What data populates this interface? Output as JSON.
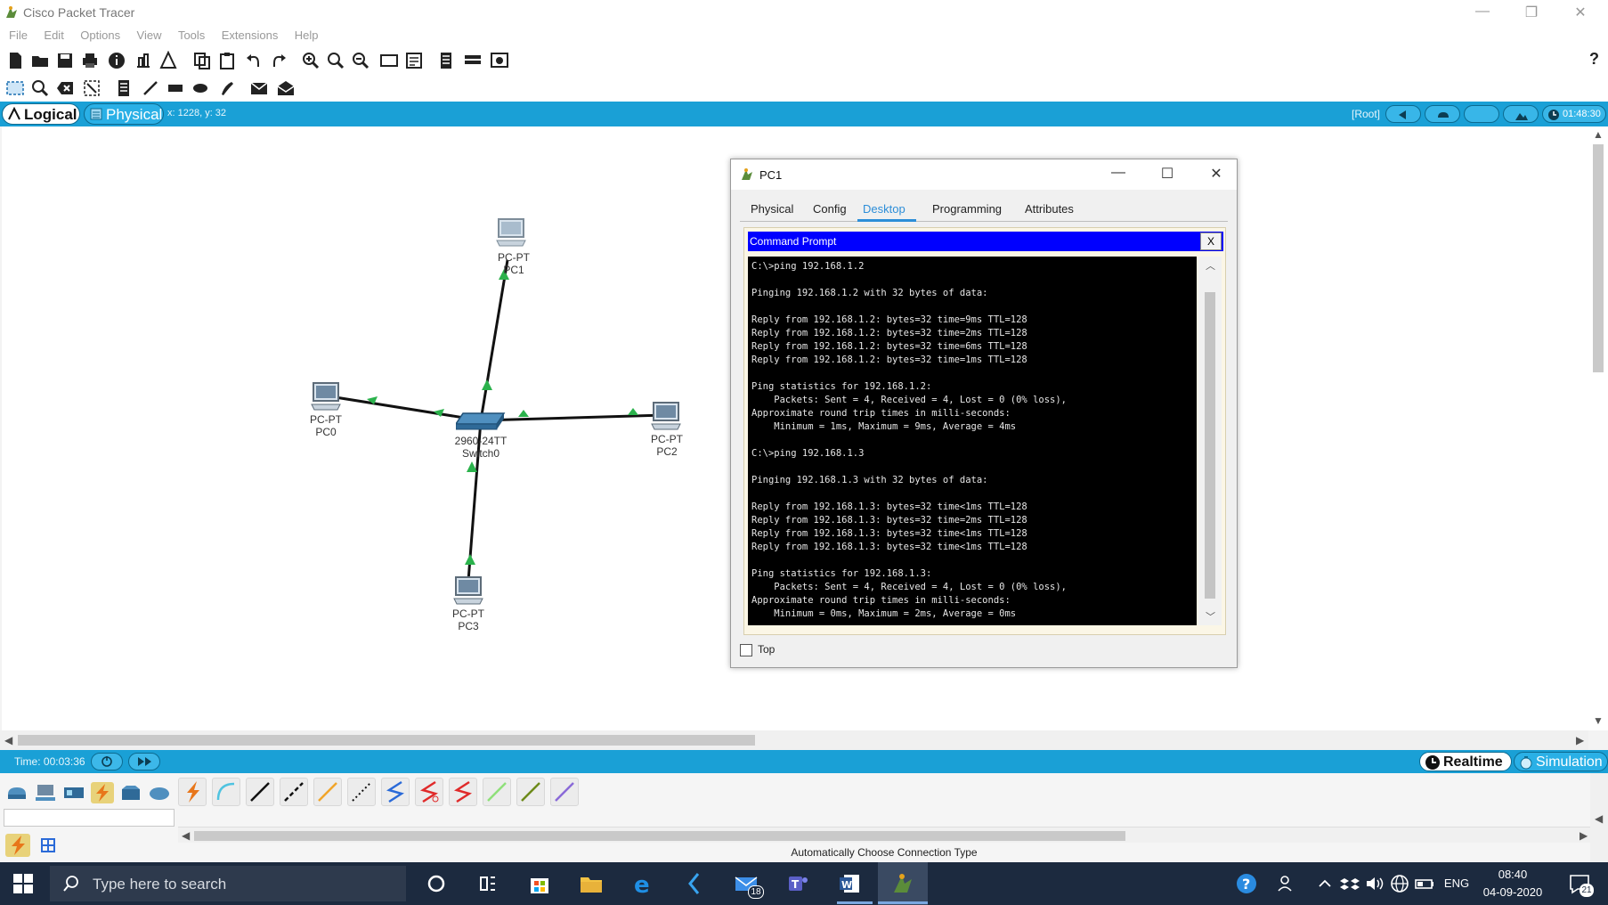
{
  "window": {
    "title": "Cisco Packet Tracer",
    "controls": {
      "minimize": "—",
      "restore": "❐",
      "close": "✕"
    }
  },
  "menu": [
    "File",
    "Edit",
    "Options",
    "View",
    "Tools",
    "Extensions",
    "Help"
  ],
  "toolbar": {
    "help": "?"
  },
  "workspace": {
    "logical_label": "Logical",
    "physical_label": "Physical",
    "coords": "x: 1228, y: 32",
    "root_label": "[Root]",
    "clock": "01:48:30"
  },
  "devices": [
    {
      "model": "PC-PT",
      "name": "PC1"
    },
    {
      "model": "PC-PT",
      "name": "PC0"
    },
    {
      "model": "2960-24TT",
      "name": "Switch0"
    },
    {
      "model": "PC-PT",
      "name": "PC2"
    },
    {
      "model": "PC-PT",
      "name": "PC3"
    }
  ],
  "dialog": {
    "title": "PC1",
    "tabs": [
      "Physical",
      "Config",
      "Desktop",
      "Programming",
      "Attributes"
    ],
    "active_tab": "Desktop",
    "cmd_title": "Command Prompt",
    "cmd_close": "X",
    "terminal_lines": [
      "C:\\>ping 192.168.1.2",
      "",
      "Pinging 192.168.1.2 with 32 bytes of data:",
      "",
      "Reply from 192.168.1.2: bytes=32 time=9ms TTL=128",
      "Reply from 192.168.1.2: bytes=32 time=2ms TTL=128",
      "Reply from 192.168.1.2: bytes=32 time=6ms TTL=128",
      "Reply from 192.168.1.2: bytes=32 time=1ms TTL=128",
      "",
      "Ping statistics for 192.168.1.2:",
      "    Packets: Sent = 4, Received = 4, Lost = 0 (0% loss),",
      "Approximate round trip times in milli-seconds:",
      "    Minimum = 1ms, Maximum = 9ms, Average = 4ms",
      "",
      "C:\\>ping 192.168.1.3",
      "",
      "Pinging 192.168.1.3 with 32 bytes of data:",
      "",
      "Reply from 192.168.1.3: bytes=32 time<1ms TTL=128",
      "Reply from 192.168.1.3: bytes=32 time=2ms TTL=128",
      "Reply from 192.168.1.3: bytes=32 time<1ms TTL=128",
      "Reply from 192.168.1.3: bytes=32 time<1ms TTL=128",
      "",
      "Ping statistics for 192.168.1.3:",
      "    Packets: Sent = 4, Received = 4, Lost = 0 (0% loss),",
      "Approximate round trip times in milli-seconds:",
      "    Minimum = 0ms, Maximum = 2ms, Average = 0ms"
    ],
    "top_label": "Top"
  },
  "bottom": {
    "time": "Time: 00:03:36",
    "realtime": "Realtime",
    "simulation": "Simulation",
    "connection_type": "Automatically Choose Connection Type"
  },
  "taskbar": {
    "search_placeholder": "Type here to search",
    "mail_badge": "18",
    "language": "ENG",
    "time": "08:40",
    "date": "04-09-2020",
    "notifications": "21"
  },
  "colors": {
    "accent_bar": "#1aa0d6",
    "cmd_header": "#0000ff",
    "link_green": "#2bb24c",
    "taskbar": "#1c2a3f"
  }
}
